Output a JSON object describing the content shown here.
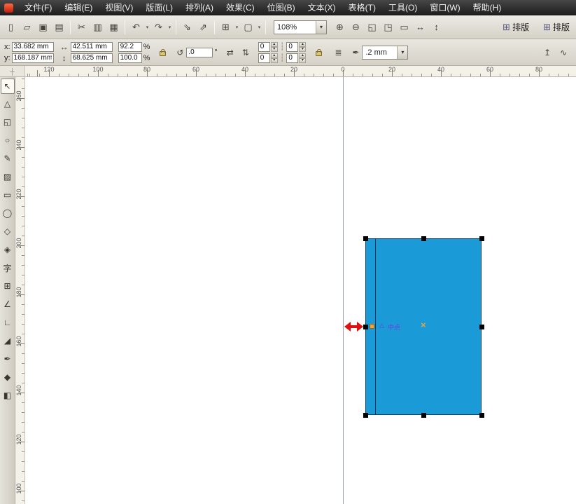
{
  "menu": {
    "items": [
      "文件(F)",
      "编辑(E)",
      "视图(V)",
      "版面(L)",
      "排列(A)",
      "效果(C)",
      "位图(B)",
      "文本(X)",
      "表格(T)",
      "工具(O)",
      "窗口(W)",
      "帮助(H)"
    ]
  },
  "icons": {
    "dropdown": "▾",
    "spin_up": "▴",
    "spin_down": "▾",
    "width": "↔",
    "height": "↕",
    "rotation": "↺",
    "mirror_h": "⇄",
    "mirror_v": "⇅",
    "corner_sep": "┆",
    "wrap_text": "≣",
    "outline_pen": "✒",
    "to_front": "↥",
    "convert_curves": "∿",
    "grid": "⊞",
    "ruler_origin": "┼",
    "snap_triangle": "△"
  },
  "toolbar": {
    "items": [
      {
        "id": "new-document-icon",
        "g": "▯",
        "cls": "tbtn",
        "ia": "true"
      },
      {
        "id": "open-icon",
        "g": "▱",
        "cls": "tbtn",
        "ia": "true"
      },
      {
        "id": "save-icon",
        "g": "▣",
        "cls": "tbtn",
        "ia": "true"
      },
      {
        "id": "print-icon",
        "g": "▤",
        "cls": "tbtn",
        "ia": "true"
      },
      {
        "id": "separator",
        "g": "",
        "cls": "tsep",
        "ia": "false"
      },
      {
        "id": "cut-icon",
        "g": "✂",
        "cls": "tbtn",
        "ia": "true"
      },
      {
        "id": "copy-icon",
        "g": "▥",
        "cls": "tbtn",
        "ia": "true"
      },
      {
        "id": "paste-icon",
        "g": "▦",
        "cls": "tbtn",
        "ia": "true"
      },
      {
        "id": "separator",
        "g": "",
        "cls": "tsep",
        "ia": "false"
      },
      {
        "id": "undo-icon",
        "g": "↶",
        "cls": "tbtn",
        "ia": "true"
      },
      {
        "id": "undo-dropdown-icon",
        "g": "▾",
        "cls": "tarr",
        "ia": "true"
      },
      {
        "id": "redo-icon",
        "g": "↷",
        "cls": "tbtn",
        "ia": "true"
      },
      {
        "id": "redo-dropdown-icon",
        "g": "▾",
        "cls": "tarr",
        "ia": "true"
      },
      {
        "id": "separator",
        "g": "",
        "cls": "tsep",
        "ia": "false"
      },
      {
        "id": "import-icon",
        "g": "⇘",
        "cls": "tbtn",
        "ia": "true"
      },
      {
        "id": "export-icon",
        "g": "⇗",
        "cls": "tbtn",
        "ia": "true"
      },
      {
        "id": "separator",
        "g": "",
        "cls": "tsep",
        "ia": "false"
      },
      {
        "id": "application-launcher-icon",
        "g": "⊞",
        "cls": "tbtn",
        "ia": "true"
      },
      {
        "id": "application-launcher-dropdown-icon",
        "g": "▾",
        "cls": "tarr",
        "ia": "true"
      },
      {
        "id": "welcome-screen-icon",
        "g": "▢",
        "cls": "tbtn",
        "ia": "true"
      },
      {
        "id": "welcome-screen-dropdown-icon",
        "g": "▾",
        "cls": "tarr",
        "ia": "true"
      },
      {
        "id": "separator",
        "g": "",
        "cls": "tsep",
        "ia": "false"
      }
    ],
    "zoom_level": "108%",
    "zoom_items": [
      {
        "id": "zoom-in-icon",
        "g": "⊕",
        "cls": "tbtn",
        "ia": "true"
      },
      {
        "id": "zoom-out-icon",
        "g": "⊖",
        "cls": "tbtn",
        "ia": "true"
      },
      {
        "id": "zoom-selected-icon",
        "g": "◱",
        "cls": "tbtn",
        "ia": "true"
      },
      {
        "id": "zoom-all-objects-icon",
        "g": "◳",
        "cls": "tbtn",
        "ia": "true"
      },
      {
        "id": "zoom-page-icon",
        "g": "▭",
        "cls": "tbtn",
        "ia": "true"
      },
      {
        "id": "zoom-page-width-icon",
        "g": "↔",
        "cls": "tbtn",
        "ia": "true"
      },
      {
        "id": "zoom-page-height-icon",
        "g": "↕",
        "cls": "tbtn",
        "ia": "true"
      }
    ],
    "layout_buttons": [
      {
        "id": "layout-docker-button",
        "label": "排版"
      },
      {
        "id": "layout-docker-button-2",
        "label": "排版"
      }
    ]
  },
  "propbar": {
    "x_label": "x:",
    "y_label": "y:",
    "x_value": "33.682 mm",
    "y_value": "168.187 mm",
    "width_value": "42.511 mm",
    "height_value": "68.625 mm",
    "scale_x": "92.2",
    "scale_y": "100.0",
    "percent": "%",
    "rotation_value": ".0",
    "degree": "°",
    "corners": [
      "0",
      "0",
      "0",
      "0"
    ],
    "outline_width": ".2 mm"
  },
  "rulers": {
    "h": [
      {
        "text": "120",
        "style": "left:34px"
      },
      {
        "text": "100",
        "style": "left:104px"
      },
      {
        "text": "80",
        "style": "left:174px"
      },
      {
        "text": "60",
        "style": "left:244px"
      },
      {
        "text": "40",
        "style": "left:314px"
      },
      {
        "text": "20",
        "style": "left:384px"
      },
      {
        "text": "0",
        "style": "left:454px"
      },
      {
        "text": "20",
        "style": "left:524px"
      },
      {
        "text": "40",
        "style": "left:594px"
      },
      {
        "text": "60",
        "style": "left:664px"
      },
      {
        "text": "80",
        "style": "left:734px"
      }
    ],
    "v": [
      {
        "text": "260",
        "style": "top:22px"
      },
      {
        "text": "240",
        "style": "top:92px"
      },
      {
        "text": "220",
        "style": "top:162px"
      },
      {
        "text": "200",
        "style": "top:232px"
      },
      {
        "text": "180",
        "style": "top:302px"
      },
      {
        "text": "160",
        "style": "top:372px"
      },
      {
        "text": "140",
        "style": "top:442px"
      },
      {
        "text": "120",
        "style": "top:512px"
      },
      {
        "text": "100",
        "style": "top:582px"
      }
    ]
  },
  "toolbox": {
    "tools": [
      {
        "id": "pick-tool",
        "glyph": "↖"
      },
      {
        "id": "shape-tool",
        "glyph": "△"
      },
      {
        "id": "crop-tool",
        "glyph": "◱"
      },
      {
        "id": "zoom-tool",
        "glyph": "○"
      },
      {
        "id": "freehand-tool",
        "glyph": "✎"
      },
      {
        "id": "smart-fill-tool",
        "glyph": "▨"
      },
      {
        "id": "rectangle-tool",
        "glyph": "▭"
      },
      {
        "id": "ellipse-tool",
        "glyph": "◯"
      },
      {
        "id": "polygon-tool",
        "glyph": "◇"
      },
      {
        "id": "basic-shapes-tool",
        "glyph": "◈"
      },
      {
        "id": "text-tool",
        "glyph": "字"
      },
      {
        "id": "table-tool",
        "glyph": "⊞"
      },
      {
        "id": "dimension-tool",
        "glyph": "∠"
      },
      {
        "id": "connector-tool",
        "glyph": "∟"
      },
      {
        "id": "eyedropper-tool",
        "glyph": "◢"
      },
      {
        "id": "outline-pen-tool",
        "glyph": "✒"
      },
      {
        "id": "fill-tool",
        "glyph": "◆"
      },
      {
        "id": "interactive-fill-tool",
        "glyph": "◧"
      }
    ]
  },
  "canvas": {
    "snap_label": "中点",
    "center_marker": "×",
    "colors": {
      "rect_fill": "#1b9ad8",
      "guideline": "#9aa3b0",
      "snap_text": "#6a3fd8",
      "node": "#f0a23c",
      "cursor": "#e01010",
      "handle": "#000000"
    }
  }
}
